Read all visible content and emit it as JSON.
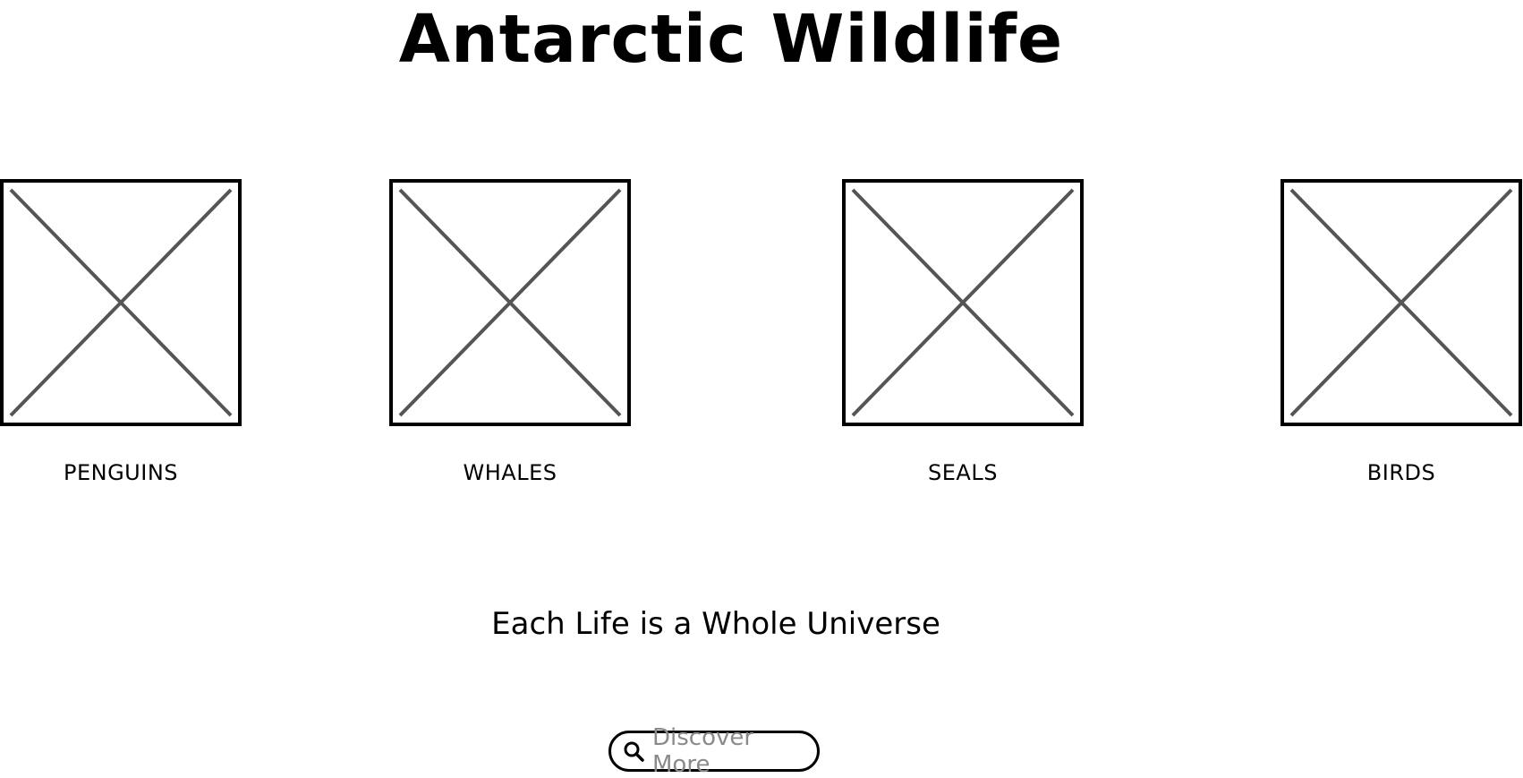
{
  "header": {
    "title": "Antarctic Wildlife"
  },
  "cards": [
    {
      "label": "PENGUINS",
      "image": "image-placeholder-icon"
    },
    {
      "label": "WHALES",
      "image": "image-placeholder-icon"
    },
    {
      "label": "SEALS",
      "image": "image-placeholder-icon"
    },
    {
      "label": "BIRDS",
      "image": "image-placeholder-icon"
    }
  ],
  "tagline": "Each Life is a Whole Universe",
  "discover": {
    "label": "Discover More",
    "icon": "search-icon"
  },
  "colors": {
    "stroke": "#000000",
    "placeholder_cross": "#555555",
    "button_text": "#8a8a8a"
  }
}
